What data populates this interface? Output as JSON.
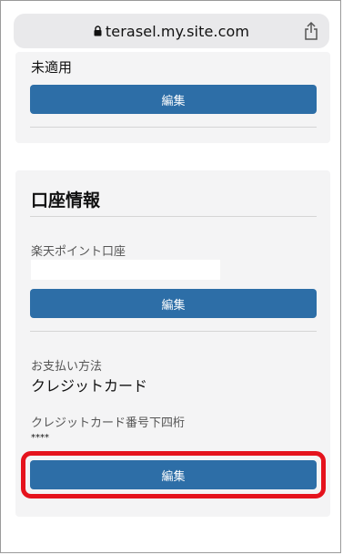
{
  "browser": {
    "url": "terasel.my.site.com",
    "icons": {
      "lock": "lock-icon",
      "share": "share-icon"
    }
  },
  "card1": {
    "status_text": "未適用",
    "edit_button_label": "編集"
  },
  "account_section": {
    "heading": "口座情報",
    "rakuten_point_label": "楽天ポイント口座",
    "rakuten_point_value": "",
    "edit_button_label": "編集",
    "payment_method_label": "お支払い方法",
    "payment_method_value": "クレジットカード",
    "card_last4_label": "クレジットカード番号下四桁",
    "card_last4_value": "****",
    "payment_edit_button_label": "編集"
  },
  "colors": {
    "button": "#2d6ea7",
    "highlight": "#e5131d",
    "card_bg": "#f4f4f5"
  }
}
